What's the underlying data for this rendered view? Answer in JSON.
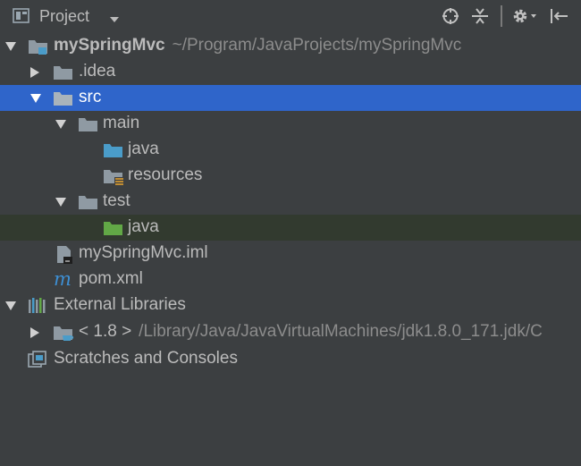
{
  "header": {
    "title": "Project"
  },
  "tree": {
    "root_label": "mySpringMvc",
    "root_path": "~/Program/JavaProjects/mySpringMvc",
    "idea_label": ".idea",
    "src_label": "src",
    "main_label": "main",
    "main_java_label": "java",
    "resources_label": "resources",
    "test_label": "test",
    "test_java_label": "java",
    "iml_label": "mySpringMvc.iml",
    "pom_label": "pom.xml",
    "ext_libs_label": "External Libraries",
    "jdk_label": "< 1.8 >",
    "jdk_path": "/Library/Java/JavaVirtualMachines/jdk1.8.0_171.jdk/C",
    "scratches_label": "Scratches and Consoles"
  },
  "colors": {
    "background": "#3c3f41",
    "selection": "#2f65ca",
    "hover_row": "#323a2f",
    "text": "#bbbbbb",
    "source_folder": "#4a9cc9",
    "test_folder": "#62a846"
  }
}
